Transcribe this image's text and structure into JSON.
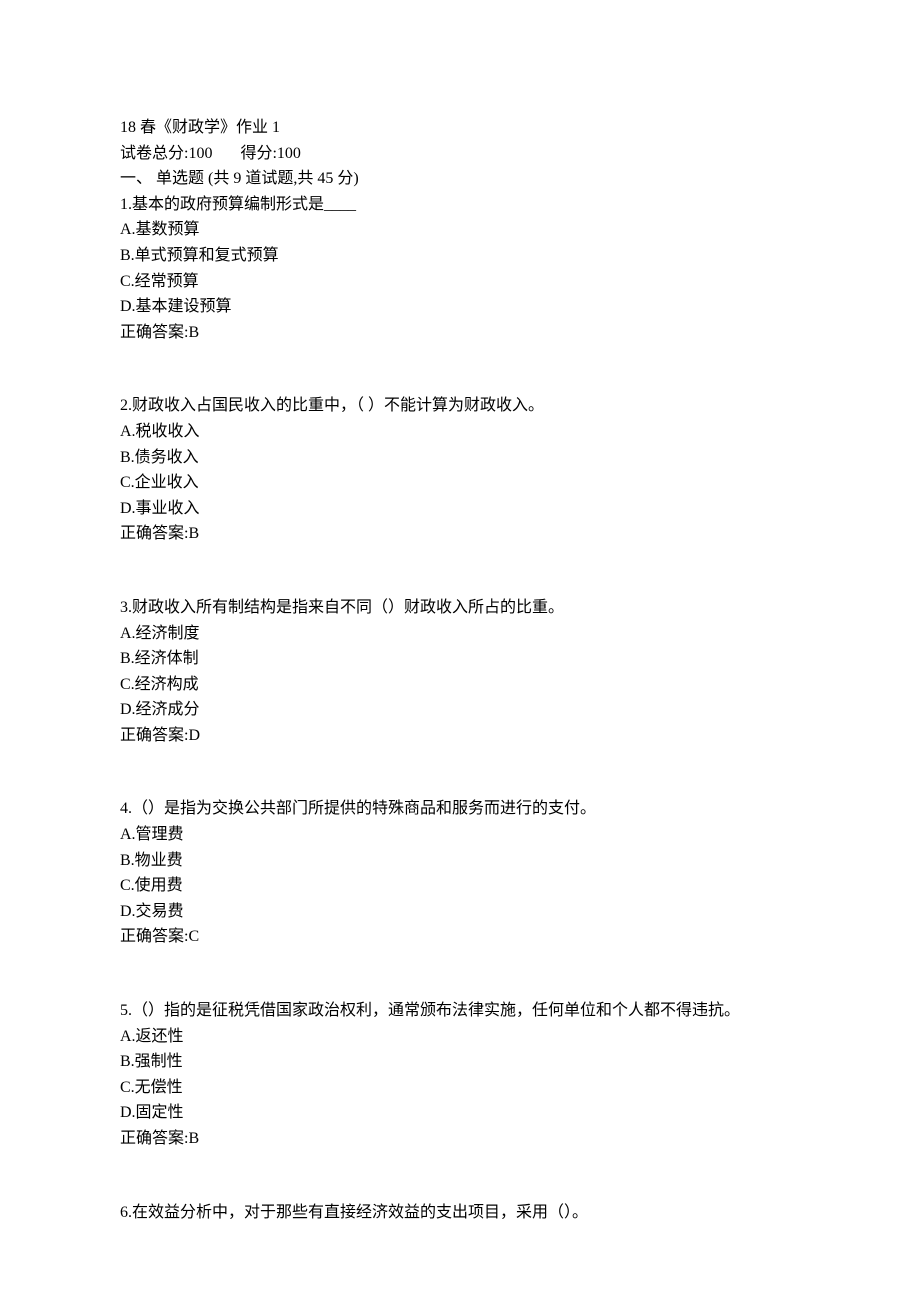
{
  "header": {
    "title": "18 春《财政学》作业 1",
    "total_label": "试卷总分:",
    "total_value": "100",
    "score_label": "得分:",
    "score_value": "100",
    "section_label": "一、  单选题 (共 9 道试题,共 45 分)"
  },
  "questions": [
    {
      "num": "1.",
      "text": "基本的政府预算编制形式是____",
      "options": [
        "A.基数预算",
        "B.单式预算和复式预算",
        "C.经常预算",
        "D.基本建设预算"
      ],
      "answer_label": "正确答案:",
      "answer": "B"
    },
    {
      "num": "2.",
      "text": "财政收入占国民收入的比重中，（  ）不能计算为财政收入。",
      "options": [
        "A.税收收入",
        "B.债务收入",
        "C.企业收入",
        "D.事业收入"
      ],
      "answer_label": "正确答案:",
      "answer": "B"
    },
    {
      "num": "3.",
      "text": "财政收入所有制结构是指来自不同（）财政收入所占的比重。",
      "options": [
        "A.经济制度",
        "B.经济体制",
        "C.经济构成",
        "D.经济成分"
      ],
      "answer_label": "正确答案:",
      "answer": "D"
    },
    {
      "num": "4.",
      "text": "（）是指为交换公共部门所提供的特殊商品和服务而进行的支付。",
      "options": [
        "A.管理费",
        "B.物业费",
        "C.使用费",
        "D.交易费"
      ],
      "answer_label": "正确答案:",
      "answer": "C"
    },
    {
      "num": "5.",
      "text": "（）指的是征税凭借国家政治权利，通常颁布法律实施，任何单位和个人都不得违抗。",
      "options": [
        "A.返还性",
        "B.强制性",
        "C.无偿性",
        "D.固定性"
      ],
      "answer_label": "正确答案:",
      "answer": "B"
    },
    {
      "num": "6.",
      "text": "在效益分析中，对于那些有直接经济效益的支出项目，采用（）。",
      "options": [],
      "answer_label": "",
      "answer": ""
    }
  ]
}
